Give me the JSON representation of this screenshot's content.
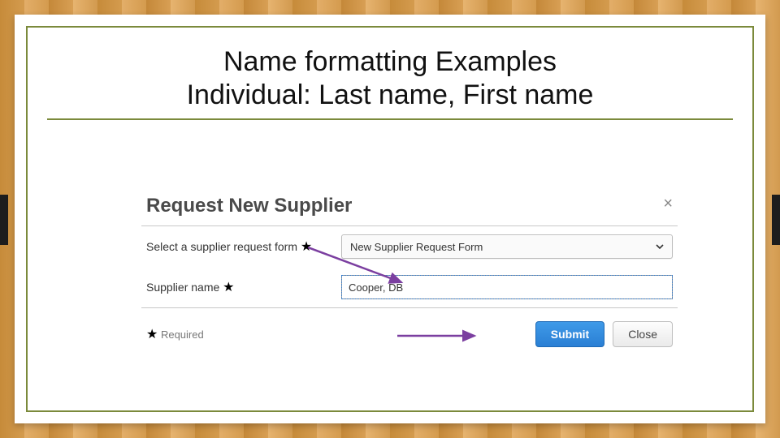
{
  "slide": {
    "title_line1": "Name formatting Examples",
    "title_line2": "Individual: Last name, First name"
  },
  "dialog": {
    "heading": "Request New Supplier",
    "close_glyph": "×",
    "row1": {
      "label": "Select a supplier request form",
      "star": "★",
      "selected": "New Supplier Request Form"
    },
    "row2": {
      "label": "Supplier name",
      "star": "★",
      "value": "Cooper, DB"
    },
    "footer": {
      "star": "★",
      "required_text": " Required",
      "submit": "Submit",
      "close": "Close"
    }
  },
  "colors": {
    "olive": "#7b8a3b",
    "arrow": "#7b3fa0"
  }
}
